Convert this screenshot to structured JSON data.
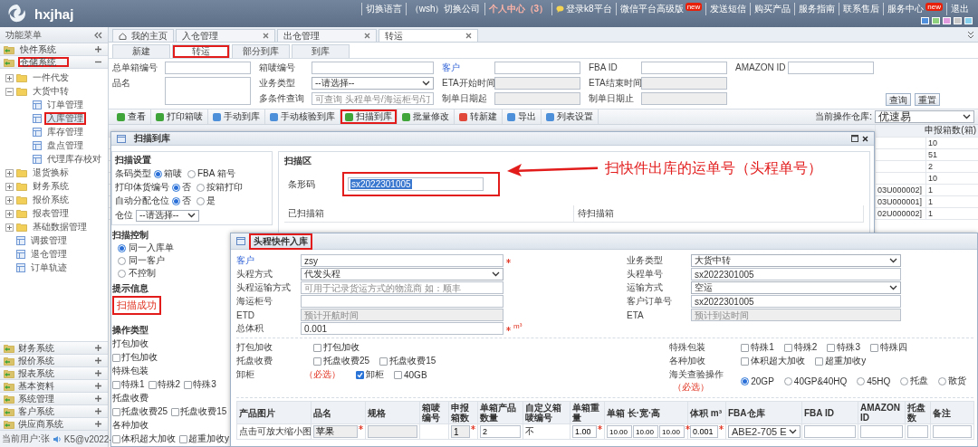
{
  "header": {
    "logo": "hxjhaj",
    "links": [
      {
        "label": "切换语言",
        "kind": "plain"
      },
      {
        "label": "（wsh）切换公司",
        "kind": "plain"
      },
      {
        "label": "个人中心（3）",
        "kind": "alert"
      },
      {
        "label": "登录k8平台",
        "kind": "icon"
      },
      {
        "label": "微信平台高级版",
        "kind": "badge",
        "badge": "new"
      },
      {
        "label": "发送短信",
        "kind": "plain"
      },
      {
        "label": "购买产品",
        "kind": "plain"
      },
      {
        "label": "服务指南",
        "kind": "plain"
      },
      {
        "label": "联系售后",
        "kind": "plain"
      },
      {
        "label": "服务中心",
        "kind": "badge",
        "badge": "new"
      },
      {
        "label": "退出",
        "kind": "plain"
      }
    ],
    "skins": [
      {
        "color": "#4f8fdc"
      },
      {
        "color": "#8fd17f"
      },
      {
        "color": "#e39be0"
      },
      {
        "color": "#c8c8c8"
      },
      {
        "color": "#86d0ee"
      }
    ]
  },
  "sidebar": {
    "title": "功能菜单",
    "top_sections": [
      {
        "label": "快件系统",
        "expanded": false,
        "annotated": false
      },
      {
        "label": "仓储系统",
        "expanded": true,
        "annotated": true
      }
    ],
    "tree": [
      {
        "label": "一件代发",
        "kind": "folder",
        "expanded": false,
        "selected": false,
        "annotated": false
      },
      {
        "label": "大货中转",
        "kind": "folder",
        "expanded": true,
        "selected": false,
        "annotated": false,
        "children": [
          {
            "label": "订单管理",
            "kind": "page",
            "selected": false,
            "annotated": false
          },
          {
            "label": "入库管理",
            "kind": "page",
            "selected": true,
            "annotated": true
          },
          {
            "label": "库存管理",
            "kind": "page",
            "selected": false,
            "annotated": false
          },
          {
            "label": "盘点管理",
            "kind": "page",
            "selected": false,
            "annotated": false
          },
          {
            "label": "代理库存校对",
            "kind": "page",
            "selected": false,
            "annotated": false
          }
        ]
      },
      {
        "label": "退货换标",
        "kind": "folder",
        "expanded": false,
        "selected": false,
        "annotated": false
      },
      {
        "label": "财务系统",
        "kind": "folder",
        "expanded": false,
        "selected": false,
        "annotated": false
      },
      {
        "label": "报价系统",
        "kind": "folder",
        "expanded": false,
        "selected": false,
        "annotated": false
      },
      {
        "label": "报表管理",
        "kind": "folder",
        "expanded": false,
        "selected": false,
        "annotated": false
      },
      {
        "label": "基础数据管理",
        "kind": "folder",
        "expanded": false,
        "selected": false,
        "annotated": false
      },
      {
        "label": "调拨管理",
        "kind": "page",
        "selected": false,
        "annotated": false
      },
      {
        "label": "退仓管理",
        "kind": "page",
        "selected": false,
        "annotated": false
      },
      {
        "label": "订单轨迹",
        "kind": "page",
        "selected": false,
        "annotated": false
      }
    ],
    "bottom_sections": [
      {
        "label": "财务系统",
        "expanded": false
      },
      {
        "label": "报价系统",
        "expanded": false
      },
      {
        "label": "报表系统",
        "expanded": false
      },
      {
        "label": "基本资料",
        "expanded": false
      },
      {
        "label": "系统管理",
        "expanded": false
      },
      {
        "label": "客户系统",
        "expanded": false
      },
      {
        "label": "供应商系统",
        "expanded": false
      }
    ],
    "footer": {
      "user": "当前用户:张",
      "version": "K5@v2022-"
    }
  },
  "tabs": [
    {
      "label": "我的主页",
      "kind": "home",
      "selected": false
    },
    {
      "label": "入仓管理",
      "kind": "page",
      "selected": false
    },
    {
      "label": "出仓管理",
      "kind": "page",
      "selected": false
    },
    {
      "label": "转运",
      "kind": "page",
      "selected": true
    }
  ],
  "subtabs": [
    {
      "label": "新建",
      "selected": false,
      "annotated": false
    },
    {
      "label": "转运",
      "selected": true,
      "annotated": true
    },
    {
      "label": "部分到库",
      "selected": false,
      "annotated": false
    },
    {
      "label": "到库",
      "selected": false,
      "annotated": false
    }
  ],
  "filter": {
    "columns": [
      [
        {
          "label": "总单箱编号",
          "kind": "text",
          "link": false
        },
        {
          "label": "品名",
          "kind": "textarea",
          "link": false
        }
      ],
      [
        {
          "label": "箱唛编号",
          "kind": "text",
          "link": false
        },
        {
          "label": "业务类型",
          "kind": "select",
          "value": "--请选择--",
          "link": false
        },
        {
          "label": "多条件查询",
          "kind": "text",
          "placeholder": "可查询 头程单号/海运柜号/订",
          "link": false
        }
      ],
      [
        {
          "label": "客户",
          "kind": "text",
          "link": true
        },
        {
          "label": "ETA开始时间",
          "kind": "date",
          "link": false
        },
        {
          "label": "制单日期起",
          "kind": "date",
          "link": false
        }
      ],
      [
        {
          "label": "FBA ID",
          "kind": "text",
          "link": false
        },
        {
          "label": "ETA结束时间",
          "kind": "date",
          "link": false
        },
        {
          "label": "制单日期止",
          "kind": "date",
          "link": false
        }
      ],
      [
        {
          "label": "AMAZON ID",
          "kind": "text",
          "link": false
        }
      ]
    ],
    "buttons": [
      "查询",
      "重置"
    ]
  },
  "toolbar": {
    "buttons": [
      {
        "label": "查看",
        "color": "#3fa43a",
        "annotated": false
      },
      {
        "label": "打印箱唛",
        "color": "#3fa43a",
        "annotated": false
      },
      {
        "label": "手动到库",
        "color": "#4d8fd8",
        "annotated": false
      },
      {
        "label": "手动核验到库",
        "color": "#4d8fd8",
        "annotated": false
      },
      {
        "label": "扫描到库",
        "color": "#3fa43a",
        "annotated": true
      },
      {
        "label": "批量修改",
        "color": "#3fa43a",
        "annotated": false
      },
      {
        "label": "转新建",
        "color": "#e0483a",
        "annotated": false
      },
      {
        "label": "导出",
        "color": "#4d8fd8",
        "annotated": false
      },
      {
        "label": "列表设置",
        "color": "#4d8fd8",
        "annotated": false
      }
    ],
    "warehouse": {
      "label": "当前操作仓库:",
      "value": "优速易"
    }
  },
  "table": {
    "header": "申报箱数(箱)",
    "rows": [
      {
        "boxes": "10"
      },
      {
        "boxes": "51"
      },
      {
        "boxes": "2"
      },
      {
        "boxes": "10"
      },
      {
        "code": "03U000002]",
        "boxes": "1"
      },
      {
        "code": "03U000001]",
        "boxes": "1"
      },
      {
        "code": "02U000002]",
        "boxes": "1"
      }
    ]
  },
  "scan_dialog": {
    "title": "扫描到库",
    "settings": {
      "title": "扫描设置",
      "options": [
        {
          "label": "条码类型",
          "choices": [
            {
              "label": "箱唛",
              "selected": true
            },
            {
              "label": "FBA 箱号",
              "selected": false
            }
          ]
        },
        {
          "label": "打印体货编号",
          "choices": [
            {
              "label": "否",
              "selected": true
            },
            {
              "label": "按箱打印",
              "selected": false
            }
          ]
        },
        {
          "label": "自动分配仓位",
          "choices": [
            {
              "label": "否",
              "selected": true
            },
            {
              "label": "是",
              "selected": false
            }
          ]
        }
      ],
      "location": {
        "label": "仓位",
        "value": "--请选择--"
      }
    },
    "control": {
      "title": "扫描控制",
      "choices": [
        {
          "label": "同一入库单",
          "selected": true
        },
        {
          "label": "同一客户",
          "selected": false
        },
        {
          "label": "不控制",
          "selected": false
        }
      ]
    },
    "message": {
      "title": "提示信息",
      "text": "扫描成功",
      "annotated": true
    },
    "operations": {
      "title": "操作类型",
      "groups": [
        {
          "label": "打包加收",
          "items": [
            {
              "label": "打包加收",
              "checked": false
            }
          ]
        },
        {
          "label": "特殊包装",
          "items": [
            {
              "label": "特殊1",
              "checked": false
            },
            {
              "label": "特殊2",
              "checked": false
            },
            {
              "label": "特殊3",
              "checked": false
            }
          ]
        },
        {
          "label": "托盘收费",
          "items": [
            {
              "label": "托盘收费25",
              "checked": false
            },
            {
              "label": "托盘收费15",
              "checked": false
            }
          ]
        },
        {
          "label": "各种加收",
          "items": [
            {
              "label": "体积超大加收",
              "checked": false
            },
            {
              "label": "超重加收y",
              "checked": false
            }
          ]
        }
      ]
    },
    "scan_area": {
      "title": "扫描区",
      "barcode": {
        "label": "条形码",
        "value": "sx2022301005",
        "annotated": true
      },
      "columns": [
        "已扫描箱",
        "待扫描箱"
      ]
    }
  },
  "annotation": {
    "text": "扫快件出库的运单号（头程单号）"
  },
  "inbound_dialog": {
    "title": "头程快件入库",
    "annotated": true,
    "fields_left": [
      {
        "label": "客户",
        "kind": "text",
        "value": "zsy",
        "required": true,
        "link": true
      },
      {
        "label": "头程方式",
        "kind": "select",
        "value": "代发头程",
        "link": false
      },
      {
        "label": "头程运输方式",
        "kind": "text",
        "placeholder": "可用于记录货运方式的物流商 如：顺丰",
        "link": false
      },
      {
        "label": "海运柜号",
        "kind": "text",
        "link": false
      },
      {
        "label": "ETD",
        "kind": "date",
        "placeholder": "预计开航时间",
        "link": false
      },
      {
        "label": "总体积",
        "kind": "text",
        "value": "0.001",
        "unit": "m³",
        "required": true,
        "link": false
      }
    ],
    "fields_right": [
      {
        "label": "业务类型",
        "kind": "select",
        "value": "大货中转",
        "link": false
      },
      {
        "label": "头程单号",
        "kind": "text",
        "value": "sx2022301005",
        "link": false
      },
      {
        "label": "运输方式",
        "kind": "select",
        "value": "空运",
        "link": false
      },
      {
        "label": "客户订单号",
        "kind": "text",
        "value": "sx2022301005",
        "link": false
      },
      {
        "label": "ETA",
        "kind": "date",
        "placeholder": "预计到达时间",
        "link": false
      }
    ],
    "options_left": [
      {
        "label": "打包加收",
        "kind": "check",
        "items": [
          {
            "label": "打包加收",
            "checked": false
          }
        ]
      },
      {
        "label": "托盘收费",
        "kind": "check",
        "items": [
          {
            "label": "托盘收费25",
            "checked": false
          },
          {
            "label": "托盘收费15",
            "checked": false
          }
        ]
      },
      {
        "label": "卸柜",
        "note": "（必选）",
        "kind": "check",
        "items": [
          {
            "label": "卸柜",
            "checked": true
          },
          {
            "label": "40GB",
            "checked": false
          }
        ]
      }
    ],
    "options_right": [
      {
        "label": "特殊包装",
        "kind": "check",
        "items": [
          {
            "label": "特殊1",
            "checked": false
          },
          {
            "label": "特殊2",
            "checked": false
          },
          {
            "label": "特殊3",
            "checked": false
          },
          {
            "label": "特殊四",
            "checked": false
          }
        ]
      },
      {
        "label": "各种加收",
        "kind": "check",
        "items": [
          {
            "label": "体积超大加收",
            "checked": false
          },
          {
            "label": "超重加收y",
            "checked": false
          }
        ]
      },
      {
        "label": "海关查验操作",
        "note": "（必选）",
        "kind": "radio",
        "items": [
          {
            "label": "20GP",
            "selected": true
          },
          {
            "label": "40GP&40HQ",
            "selected": false
          },
          {
            "label": "45HQ",
            "selected": false
          },
          {
            "label": "托盘",
            "selected": false
          },
          {
            "label": "散货",
            "selected": false
          }
        ]
      }
    ],
    "products": {
      "columns": [
        "产品图片",
        "品名",
        "规格",
        "箱唛编号",
        "申报箱数",
        "单箱产品数量",
        "自定义箱唛编号",
        "单箱重量",
        "单箱 长·宽·高",
        "体积 m³",
        "FBA仓库",
        "FBA ID",
        "AMAZON ID",
        "托盘数",
        "备注"
      ],
      "rows": [
        {
          "cells": [
            {
              "kind": "text",
              "value": "点击可放大缩小图"
            },
            {
              "kind": "readonly",
              "value": "苹果",
              "required": true
            },
            {
              "kind": "readonly"
            },
            {
              "kind": "blank"
            },
            {
              "kind": "readonly",
              "value": "1",
              "required": true
            },
            {
              "kind": "input",
              "value": "2"
            },
            {
              "kind": "text",
              "value": "不"
            },
            {
              "kind": "input",
              "value": "1.00",
              "required": true
            },
            {
              "kind": "dims",
              "values": [
                "10.00",
                "10.00",
                "10.00"
              ],
              "required": true
            },
            {
              "kind": "input",
              "value": "0.001",
              "required": true
            },
            {
              "kind": "select",
              "value": "ABE2-705 E"
            },
            {
              "kind": "input"
            },
            {
              "kind": "input"
            },
            {
              "kind": "input"
            },
            {
              "kind": "input"
            }
          ]
        }
      ]
    }
  }
}
